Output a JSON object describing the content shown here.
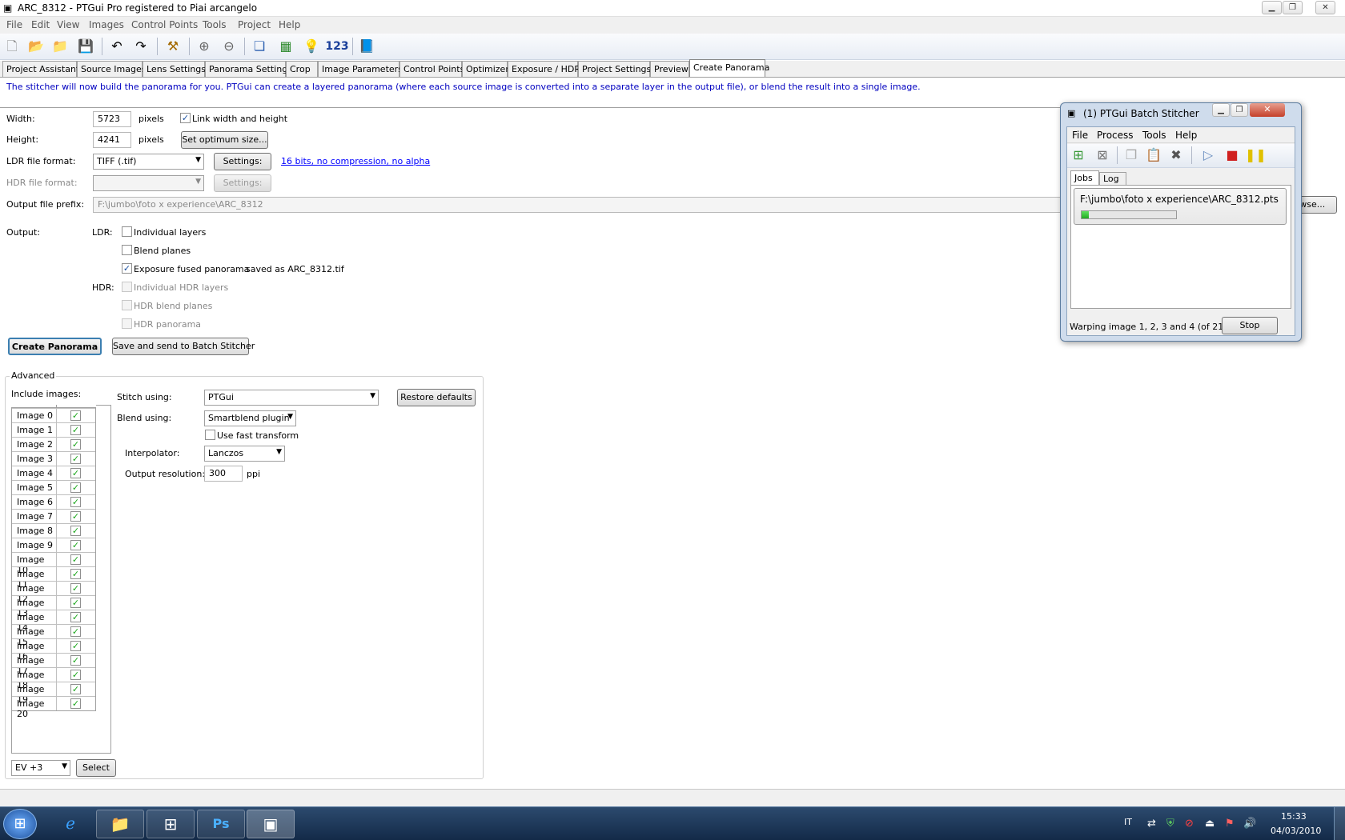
{
  "window": {
    "title": "ARC_8312 - PTGui Pro registered to Piai arcangelo"
  },
  "menu": [
    "File",
    "Edit",
    "View",
    "Images",
    "Control Points",
    "Tools",
    "Project",
    "Help"
  ],
  "toolbar": {
    "number_label": "123"
  },
  "tabs": [
    "Project Assistant",
    "Source Images",
    "Lens Settings",
    "Panorama Settings",
    "Crop",
    "Image Parameters",
    "Control Points",
    "Optimizer",
    "Exposure / HDR",
    "Project Settings",
    "Preview",
    "Create Panorama"
  ],
  "intro": "The stitcher will now build the panorama for you. PTGui can create a layered panorama (where each source image is converted into a separate layer in the output file), or blend the result into a single image.",
  "form": {
    "width_label": "Width:",
    "width_value": "5723",
    "height_label": "Height:",
    "height_value": "4241",
    "pixels": "pixels",
    "link_label": "Link width and height",
    "optimum_btn": "Set optimum size...",
    "ldr_label": "LDR file format:",
    "ldr_value": "TIFF (.tif)",
    "settings_btn": "Settings:",
    "ldr_settings_link": "16 bits, no compression, no alpha",
    "hdr_label": "HDR file format:",
    "prefix_label": "Output file prefix:",
    "prefix_value": "F:\\jumbo\\foto x experience\\ARC_8312",
    "browse_btn": "Browse...",
    "output_label": "Output:",
    "ldr_short": "LDR:",
    "hdr_short": "HDR:",
    "individual_layers": "Individual layers",
    "blend_planes": "Blend planes",
    "exposure_fused": "Exposure fused panorama",
    "saved_as": "saved as ARC_8312.tif",
    "individual_hdr": "Individual HDR layers",
    "hdr_blend_planes": "HDR blend planes",
    "hdr_panorama": "HDR panorama",
    "create_btn": "Create Panorama",
    "batch_btn": "Save and send to Batch Stitcher"
  },
  "advanced": {
    "title": "Advanced",
    "include_label": "Include images:",
    "images": [
      "Image 0",
      "Image 1",
      "Image 2",
      "Image 3",
      "Image 4",
      "Image 5",
      "Image 6",
      "Image 7",
      "Image 8",
      "Image 9",
      "Image 10",
      "Image 11",
      "Image 12",
      "Image 13",
      "Image 14",
      "Image 15",
      "Image 16",
      "Image 17",
      "Image 18",
      "Image 19",
      "Image 20"
    ],
    "ev_value": "EV +3",
    "select_btn": "Select",
    "stitch_label": "Stitch using:",
    "stitch_value": "PTGui",
    "restore_btn": "Restore defaults",
    "blend_label": "Blend using:",
    "blend_value": "Smartblend plugin",
    "fast_transform": "Use fast transform",
    "interp_label": "Interpolator:",
    "interp_value": "Lanczos",
    "res_label": "Output resolution:",
    "res_value": "300",
    "ppi": "ppi"
  },
  "batch": {
    "title": "(1) PTGui Batch Stitcher",
    "menu": [
      "File",
      "Process",
      "Tools",
      "Help"
    ],
    "tabs": [
      "Jobs",
      "Log"
    ],
    "job": "F:\\jumbo\\foto x experience\\ARC_8312.pts",
    "progress": 0.08,
    "status": "Warping image 1, 2, 3 and 4 (of 21)",
    "stop_btn": "Stop"
  },
  "taskbar": {
    "lang": "IT",
    "time": "15:33",
    "date": "04/03/2010"
  },
  "colors": {
    "accent": "#3c7fb1",
    "link": "#0000ff",
    "intro_text": "#0000c0"
  }
}
